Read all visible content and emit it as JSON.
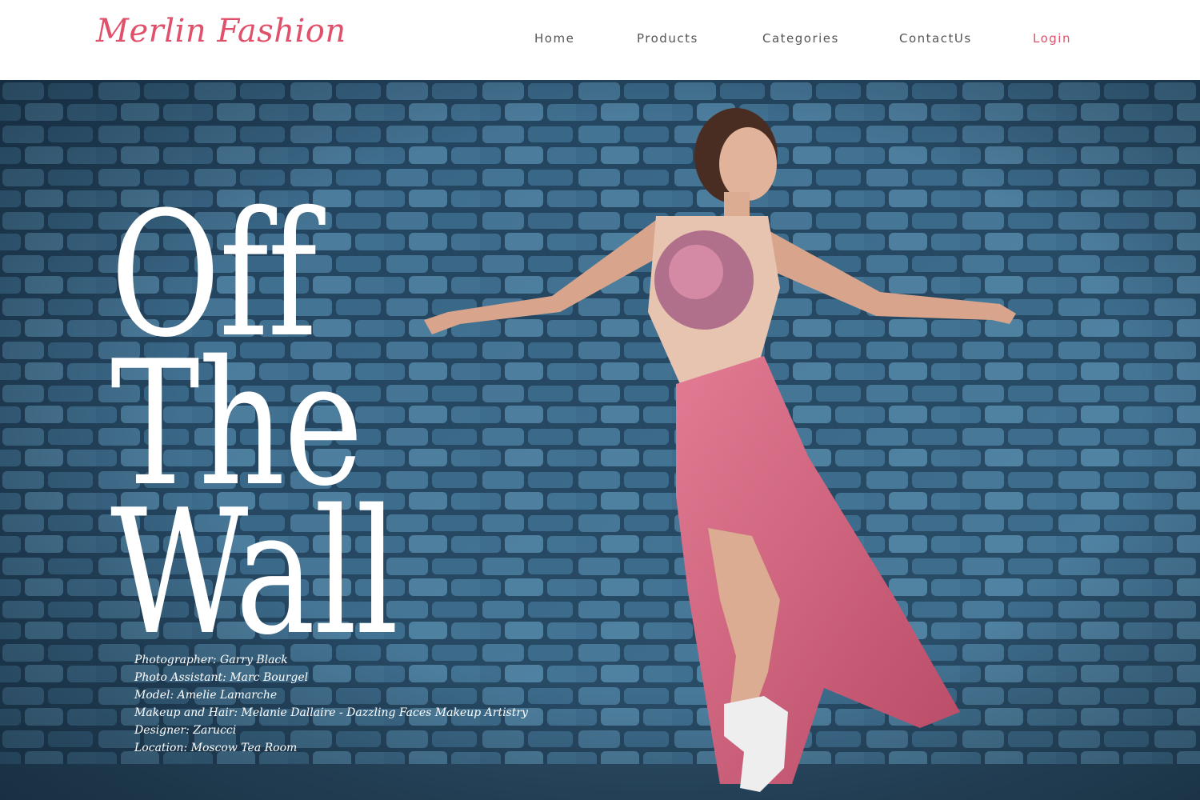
{
  "brand": {
    "name": "Merlin Fashion",
    "color": "#e0506a"
  },
  "nav": {
    "items": [
      {
        "label": "Home"
      },
      {
        "label": "Products"
      },
      {
        "label": "Categories"
      },
      {
        "label": "ContactUs"
      },
      {
        "label": "Login",
        "accent": true
      }
    ],
    "accent_color": "#e0506a"
  },
  "hero": {
    "headline": [
      "Off",
      "The",
      "Wall"
    ],
    "credits": [
      "Photographer: Garry Black",
      "Photo Assistant: Marc Bourgel",
      "Model: Amelie Lamarche",
      "Makeup and Hair: Melanie Dallaire - Dazzling Faces Makeup Artistry",
      "Designer: Zarucci",
      "Location: Moscow Tea Room"
    ],
    "background_colors": {
      "wall": "#3f6f8e",
      "mortar": "#1e3a52",
      "dress": "#d86a84"
    }
  }
}
